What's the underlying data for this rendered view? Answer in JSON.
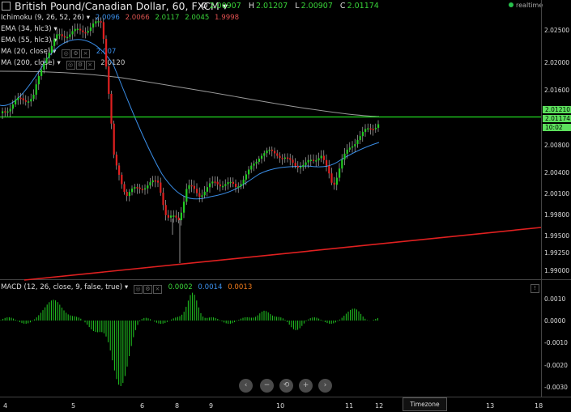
{
  "header": {
    "title": "British Pound/Canadian Dollar, 60, FXCM",
    "ohlc": [
      {
        "k": "O",
        "v": "2.00907"
      },
      {
        "k": "H",
        "v": "2.01207"
      },
      {
        "k": "L",
        "v": "2.00907"
      },
      {
        "k": "C",
        "v": "2.01174"
      }
    ],
    "status": "realtime",
    "status_color": "#27c24c"
  },
  "indicators": [
    {
      "label": "Ichimoku (9, 26, 52, 26)",
      "values": [
        {
          "text": "2.0096",
          "color": "#3a8ee8"
        },
        {
          "text": "2.0066",
          "color": "#d9534f"
        },
        {
          "text": "2.0117",
          "color": "#39d339"
        },
        {
          "text": "2.0045",
          "color": "#39d339"
        },
        {
          "text": "1.9998",
          "color": "#e05050"
        }
      ]
    },
    {
      "label": "EMA (34, hlc3)",
      "values": []
    },
    {
      "label": "EMA (55, hlc3)",
      "values": []
    },
    {
      "label": "MA (20, close)",
      "values": [
        {
          "text": "2.007",
          "color": "#3a8ee8"
        }
      ]
    },
    {
      "label": "MA (200, close)",
      "values": [
        {
          "text": "2.0120",
          "color": "#cccccc"
        }
      ]
    }
  ],
  "price_axis": {
    "labels": [
      "2.02500",
      "2.02000",
      "2.01600",
      "2.01210",
      "2.01174",
      "10:02",
      "2.00800",
      "2.00400",
      "2.00100",
      "1.99800",
      "1.99500",
      "1.99250",
      "1.99000"
    ],
    "tags": [
      {
        "text": "2.01210",
        "color": "#5ce05c"
      },
      {
        "text": "2.01174",
        "color": "#5ce05c"
      },
      {
        "text": "10:02",
        "color": "#5ce05c"
      }
    ]
  },
  "macd": {
    "label": "MACD (12, 26, close, 9, false, true)",
    "values": [
      {
        "text": "0.0002",
        "color": "#39d339"
      },
      {
        "text": "0.0014",
        "color": "#3a8ee8"
      },
      {
        "text": "0.0013",
        "color": "#f07a1a"
      }
    ],
    "axis_labels": [
      "0.0010",
      "0.0000",
      "-0.0010",
      "-0.0020",
      "-0.0030"
    ]
  },
  "time_axis": {
    "labels": [
      "4",
      "5",
      "6",
      "8",
      "9",
      "10",
      "11",
      "12",
      "13",
      "18"
    ],
    "timezone_label": "Timezone"
  },
  "nav": [
    "‹",
    "−",
    "⟲",
    "+",
    "›"
  ],
  "colors": {
    "horizontal_line": "#22dd22",
    "trend_line": "#e02020",
    "up_candle": "#22cc22",
    "down_candle": "#e02020",
    "ma20": "#3a8ee8",
    "ma200": "#cccccc",
    "macd_hist": "#22cc22"
  }
}
